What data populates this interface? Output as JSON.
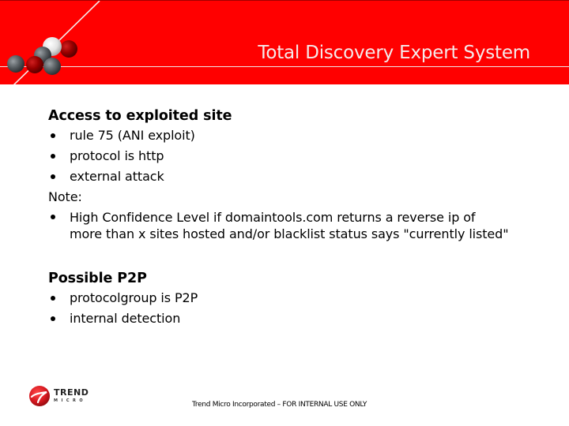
{
  "header": {
    "title": "Total Discovery Expert System",
    "background_color": "#ff0000"
  },
  "sections": [
    {
      "heading": "Access to exploited site",
      "bullets": [
        "rule 75 (ANI exploit)",
        "protocol is http",
        "external attack"
      ],
      "note": {
        "label": "Note:",
        "bullets": [
          {
            "line1": "High Confidence Level if domaintools.com returns a reverse ip of",
            "line2": "more than x sites hosted and/or blacklist status says \"currently listed\""
          }
        ]
      }
    },
    {
      "heading": "Possible P2P",
      "bullets": [
        "protocolgroup is P2P",
        "internal detection"
      ]
    }
  ],
  "footer": {
    "logo": {
      "brand_top": "TREND",
      "brand_bottom": "MICRO",
      "icon": "trend-micro-logo-icon",
      "color": "#d71920"
    },
    "text": "Trend Micro Incorporated – FOR INTERNAL USE ONLY"
  }
}
